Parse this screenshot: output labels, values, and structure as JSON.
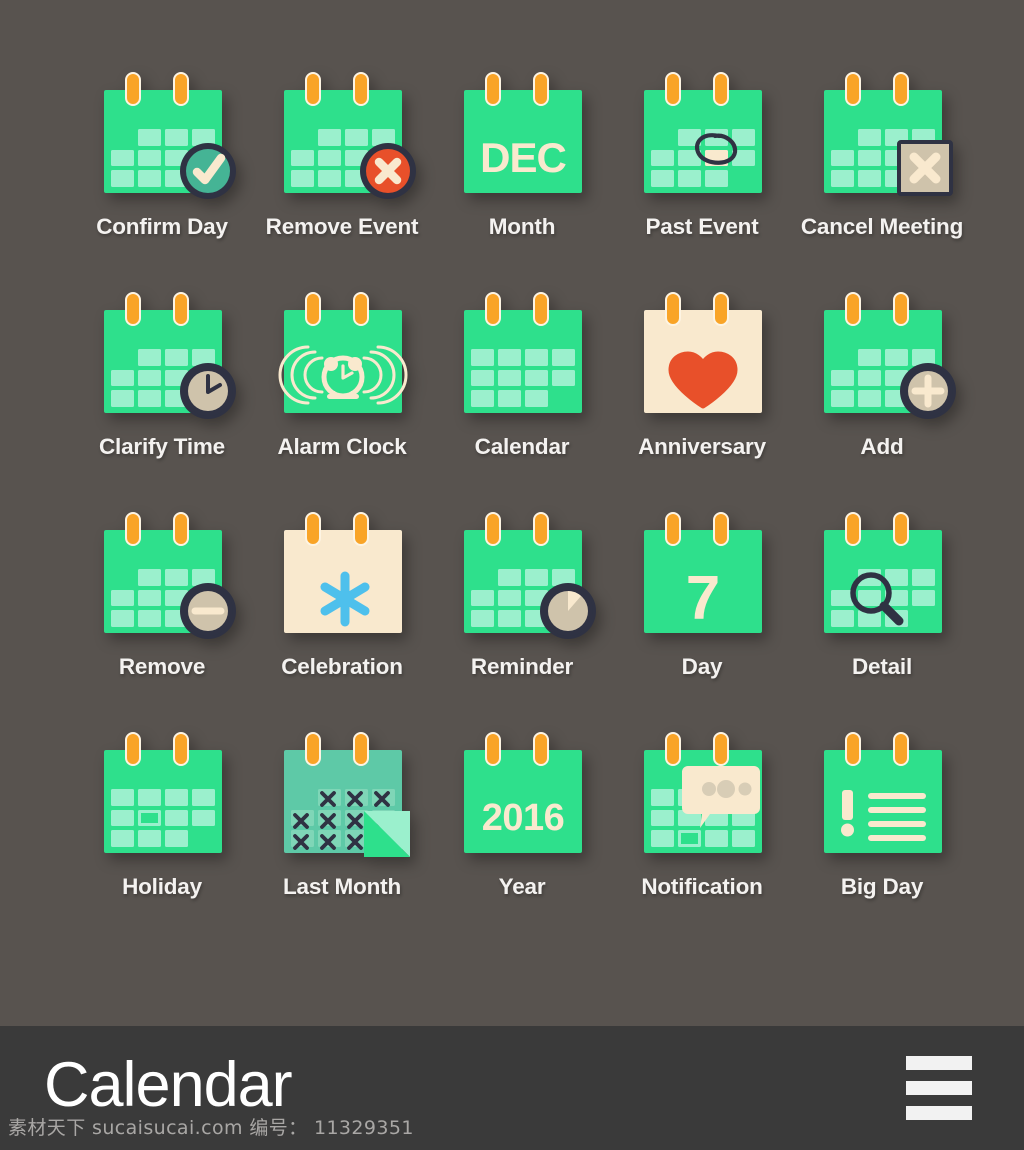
{
  "page": {
    "background_color": "#58534f",
    "accent_green": "#2ee08c",
    "cell_green": "#9bf0cd",
    "header_navy": "#2f3243",
    "ring_orange": "#f9a427",
    "cream": "#f9e9ce",
    "red": "#e8502a",
    "blue": "#4ec0ec",
    "tan": "#cfc3ab"
  },
  "icons": [
    {
      "id": "confirm-day",
      "label": "Confirm Day",
      "badge": "check-circle-icon"
    },
    {
      "id": "remove-event",
      "label": "Remove Event",
      "badge": "x-circle-icon"
    },
    {
      "id": "month",
      "label": "Month",
      "big_text": "DEC"
    },
    {
      "id": "past-event",
      "label": "Past Event",
      "badge": "scribble-circle-icon"
    },
    {
      "id": "cancel-meeting",
      "label": "Cancel Meeting",
      "badge": "x-square-icon"
    },
    {
      "id": "clarify-time",
      "label": "Clarify Time",
      "badge": "clock-icon"
    },
    {
      "id": "alarm-clock",
      "label": "Alarm Clock",
      "badge": "alarm-clock-icon"
    },
    {
      "id": "calendar",
      "label": "Calendar",
      "badge": "none"
    },
    {
      "id": "anniversary",
      "label": "Anniversary",
      "badge": "heart-icon"
    },
    {
      "id": "add",
      "label": "Add",
      "badge": "plus-circle-icon"
    },
    {
      "id": "remove",
      "label": "Remove",
      "badge": "minus-circle-icon"
    },
    {
      "id": "celebration",
      "label": "Celebration",
      "badge": "sparkle-icon"
    },
    {
      "id": "reminder",
      "label": "Reminder",
      "badge": "pie-timer-icon"
    },
    {
      "id": "day",
      "label": "Day",
      "big_text": "7"
    },
    {
      "id": "detail",
      "label": "Detail",
      "badge": "magnifier-icon"
    },
    {
      "id": "holiday",
      "label": "Holiday",
      "badge": "highlighted-day-icon"
    },
    {
      "id": "last-month",
      "label": "Last Month",
      "badge": "crossed-days-icon"
    },
    {
      "id": "year",
      "label": "Year",
      "big_text": "2016"
    },
    {
      "id": "notification",
      "label": "Notification",
      "badge": "speech-bubble-icon"
    },
    {
      "id": "big-day",
      "label": "Big Day",
      "badge": "exclamation-lines-icon"
    }
  ],
  "bottom_bar": {
    "title": "Calendar",
    "menu_icon": "hamburger-menu-icon"
  },
  "watermark": {
    "text": "素材天下 sucaisucai.com  编号： 11329351"
  }
}
